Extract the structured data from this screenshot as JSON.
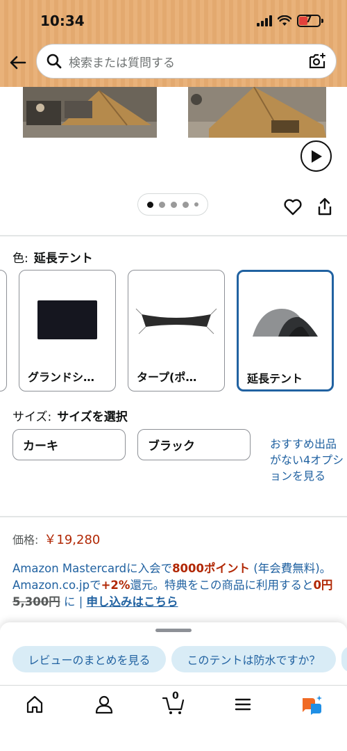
{
  "status_bar": {
    "time": "10:34",
    "battery": "7"
  },
  "search": {
    "placeholder": "検索または質問する"
  },
  "color": {
    "label": "色:",
    "selected": "延長テント"
  },
  "swatches": [
    {
      "label": "グランドシ…"
    },
    {
      "label": "タープ(ポ…"
    },
    {
      "label": "延長テント"
    }
  ],
  "size": {
    "label": "サイズ:",
    "selected": "サイズを選択",
    "options": [
      "カーキ",
      "ブラック"
    ],
    "note": "おすすめ出品がない4オプションを見る"
  },
  "price": {
    "label": "価格:",
    "value": "￥19,280"
  },
  "promo": {
    "part1": "Amazon Mastercardに入会で",
    "points": "8000ポイント",
    "part2": " (年会費無料)。 Amazon.co.jpで",
    "percent": "+2%",
    "part3": "還元。特典をこの商品に利用すると",
    "zero": "0円",
    "original": "5,300円",
    "part4": " に | ",
    "link": "申し込みはこちら"
  },
  "chips": [
    "レビューのまとめを見る",
    "このテントは防水ですか？"
  ],
  "nav": {
    "cart_count": "0"
  },
  "colors": {
    "accent_blue": "#2162a1",
    "price_red": "#b12704",
    "header_tan": "#e9b27a",
    "chip_bg": "#d9ecf6"
  }
}
